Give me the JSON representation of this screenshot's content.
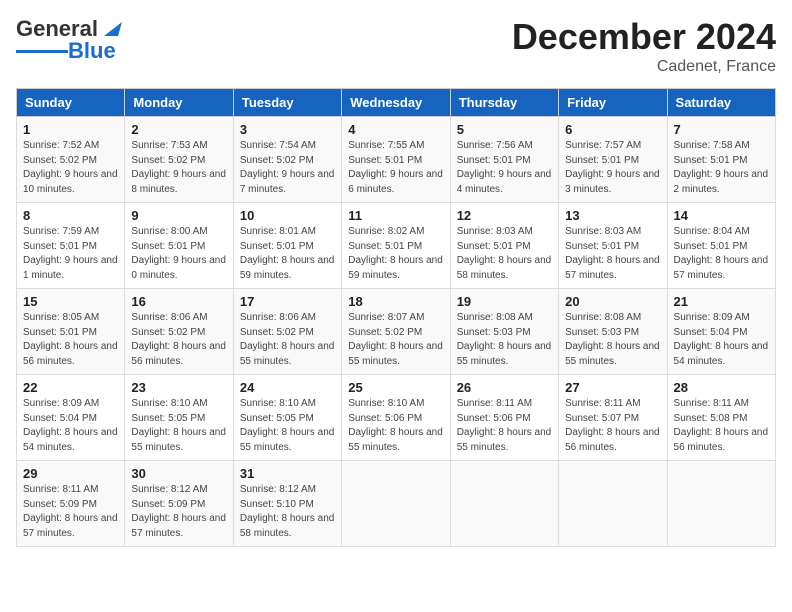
{
  "header": {
    "logo_line1": "General",
    "logo_line2": "Blue",
    "title": "December 2024",
    "subtitle": "Cadenet, France"
  },
  "days_of_week": [
    "Sunday",
    "Monday",
    "Tuesday",
    "Wednesday",
    "Thursday",
    "Friday",
    "Saturday"
  ],
  "weeks": [
    [
      {
        "day": 1,
        "sunrise": "7:52 AM",
        "sunset": "5:02 PM",
        "daylight": "9 hours and 10 minutes."
      },
      {
        "day": 2,
        "sunrise": "7:53 AM",
        "sunset": "5:02 PM",
        "daylight": "9 hours and 8 minutes."
      },
      {
        "day": 3,
        "sunrise": "7:54 AM",
        "sunset": "5:02 PM",
        "daylight": "9 hours and 7 minutes."
      },
      {
        "day": 4,
        "sunrise": "7:55 AM",
        "sunset": "5:01 PM",
        "daylight": "9 hours and 6 minutes."
      },
      {
        "day": 5,
        "sunrise": "7:56 AM",
        "sunset": "5:01 PM",
        "daylight": "9 hours and 4 minutes."
      },
      {
        "day": 6,
        "sunrise": "7:57 AM",
        "sunset": "5:01 PM",
        "daylight": "9 hours and 3 minutes."
      },
      {
        "day": 7,
        "sunrise": "7:58 AM",
        "sunset": "5:01 PM",
        "daylight": "9 hours and 2 minutes."
      }
    ],
    [
      {
        "day": 8,
        "sunrise": "7:59 AM",
        "sunset": "5:01 PM",
        "daylight": "9 hours and 1 minute."
      },
      {
        "day": 9,
        "sunrise": "8:00 AM",
        "sunset": "5:01 PM",
        "daylight": "9 hours and 0 minutes."
      },
      {
        "day": 10,
        "sunrise": "8:01 AM",
        "sunset": "5:01 PM",
        "daylight": "8 hours and 59 minutes."
      },
      {
        "day": 11,
        "sunrise": "8:02 AM",
        "sunset": "5:01 PM",
        "daylight": "8 hours and 59 minutes."
      },
      {
        "day": 12,
        "sunrise": "8:03 AM",
        "sunset": "5:01 PM",
        "daylight": "8 hours and 58 minutes."
      },
      {
        "day": 13,
        "sunrise": "8:03 AM",
        "sunset": "5:01 PM",
        "daylight": "8 hours and 57 minutes."
      },
      {
        "day": 14,
        "sunrise": "8:04 AM",
        "sunset": "5:01 PM",
        "daylight": "8 hours and 57 minutes."
      }
    ],
    [
      {
        "day": 15,
        "sunrise": "8:05 AM",
        "sunset": "5:01 PM",
        "daylight": "8 hours and 56 minutes."
      },
      {
        "day": 16,
        "sunrise": "8:06 AM",
        "sunset": "5:02 PM",
        "daylight": "8 hours and 56 minutes."
      },
      {
        "day": 17,
        "sunrise": "8:06 AM",
        "sunset": "5:02 PM",
        "daylight": "8 hours and 55 minutes."
      },
      {
        "day": 18,
        "sunrise": "8:07 AM",
        "sunset": "5:02 PM",
        "daylight": "8 hours and 55 minutes."
      },
      {
        "day": 19,
        "sunrise": "8:08 AM",
        "sunset": "5:03 PM",
        "daylight": "8 hours and 55 minutes."
      },
      {
        "day": 20,
        "sunrise": "8:08 AM",
        "sunset": "5:03 PM",
        "daylight": "8 hours and 55 minutes."
      },
      {
        "day": 21,
        "sunrise": "8:09 AM",
        "sunset": "5:04 PM",
        "daylight": "8 hours and 54 minutes."
      }
    ],
    [
      {
        "day": 22,
        "sunrise": "8:09 AM",
        "sunset": "5:04 PM",
        "daylight": "8 hours and 54 minutes."
      },
      {
        "day": 23,
        "sunrise": "8:10 AM",
        "sunset": "5:05 PM",
        "daylight": "8 hours and 55 minutes."
      },
      {
        "day": 24,
        "sunrise": "8:10 AM",
        "sunset": "5:05 PM",
        "daylight": "8 hours and 55 minutes."
      },
      {
        "day": 25,
        "sunrise": "8:10 AM",
        "sunset": "5:06 PM",
        "daylight": "8 hours and 55 minutes."
      },
      {
        "day": 26,
        "sunrise": "8:11 AM",
        "sunset": "5:06 PM",
        "daylight": "8 hours and 55 minutes."
      },
      {
        "day": 27,
        "sunrise": "8:11 AM",
        "sunset": "5:07 PM",
        "daylight": "8 hours and 56 minutes."
      },
      {
        "day": 28,
        "sunrise": "8:11 AM",
        "sunset": "5:08 PM",
        "daylight": "8 hours and 56 minutes."
      }
    ],
    [
      {
        "day": 29,
        "sunrise": "8:11 AM",
        "sunset": "5:09 PM",
        "daylight": "8 hours and 57 minutes."
      },
      {
        "day": 30,
        "sunrise": "8:12 AM",
        "sunset": "5:09 PM",
        "daylight": "8 hours and 57 minutes."
      },
      {
        "day": 31,
        "sunrise": "8:12 AM",
        "sunset": "5:10 PM",
        "daylight": "8 hours and 58 minutes."
      },
      null,
      null,
      null,
      null
    ]
  ]
}
